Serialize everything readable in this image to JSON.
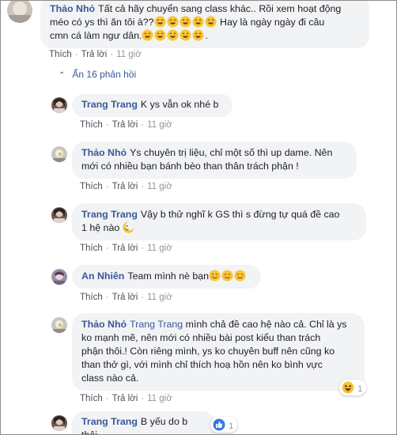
{
  "comments": [
    {
      "author": "Thảo Nhỏ",
      "line1": "Tất cả hãy chuyển sang class khác.. Rồi xem hoạt động",
      "line2a": "méo có ys thì ăn tôi à??",
      "line2b": " Hay là ngày ngày đi câu",
      "line3": "cmn cá làm ngư dân.",
      "line3_end": ".",
      "like": "Thích",
      "reply": "Trả lời",
      "time": "11 giờ"
    }
  ],
  "replies_toggle": "Ẩn 16 phản hồi",
  "replies": [
    {
      "author": "Trang Trang",
      "text": "K ys vẫn ok nhé b",
      "like": "Thích",
      "reply": "Trả lời",
      "time": "11 giờ"
    },
    {
      "author": "Thảo Nhỏ",
      "line1": "Ys chuyên trị liệu, chỉ một số thì up dame. Nên",
      "line2": "mới có nhiều bạn bánh bèo than thân trách phận !",
      "like": "Thích",
      "reply": "Trả lời",
      "time": "11 giờ"
    },
    {
      "author": "Trang Trang",
      "line1": "Vậy b thử nghĩ k GS thì s đừng tự quá đề cao",
      "line2": "1 hệ nào",
      "like": "Thích",
      "reply": "Trả lời",
      "time": "11 giờ"
    },
    {
      "author": "An Nhiên",
      "text": "Team mình nè bạn",
      "like": "Thích",
      "reply": "Trả lời",
      "time": "11 giờ"
    },
    {
      "author": "Thảo Nhỏ",
      "mention": "Trang Trang",
      "line1": " mình chả đề cao hệ nào cả. Chỉ là ys",
      "line2": "ko mạnh mẽ, nên mới có nhiều bài post kiểu than trách",
      "line3": "phận thôi.! Còn riêng mình, ys ko chuyên buff nên cũng ko",
      "line4": "than thở gì, với mình chỉ thích hoạ hồn nên ko bình vực",
      "line5": "class nào cả.",
      "reaction_count": "1",
      "like": "Thích",
      "reply": "Trả lời",
      "time": "11 giờ"
    },
    {
      "author": "Trang Trang",
      "text": "B yếu do b thôi",
      "reaction_count": "1"
    }
  ],
  "colors": {
    "link": "#385898",
    "bubble": "#f2f3f5",
    "meta": "#90949c"
  }
}
